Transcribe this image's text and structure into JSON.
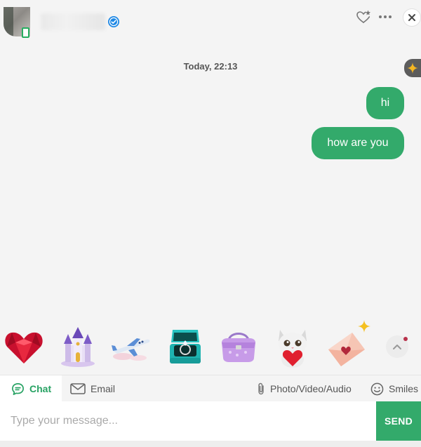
{
  "header": {
    "contact_name": "",
    "icons": [
      "avatar",
      "mobile-icon",
      "verified-badge-icon",
      "heart-star-icon",
      "more-icon",
      "close-icon"
    ]
  },
  "conversation": {
    "date_label": "Today, 22:13",
    "messages": [
      {
        "text": "hi",
        "direction": "outgoing"
      },
      {
        "text": "how are you",
        "direction": "outgoing"
      }
    ]
  },
  "gifts": {
    "items": [
      "red-heart-gift",
      "castle-gift",
      "airplane-gift",
      "ring-box-gift",
      "purse-gift",
      "kitten-heart-gift",
      "love-letter-gift"
    ]
  },
  "tabs": {
    "chat": "Chat",
    "email": "Email",
    "media": "Photo/Video/Audio",
    "smiles": "Smiles",
    "active": "chat"
  },
  "composer": {
    "placeholder": "Type your message...",
    "value": "",
    "send_label": "SEND"
  },
  "colors": {
    "accent": "#33aa6b",
    "background": "#f4f4f4",
    "verified": "#1e88e5",
    "notification_dot": "#b8324b"
  }
}
